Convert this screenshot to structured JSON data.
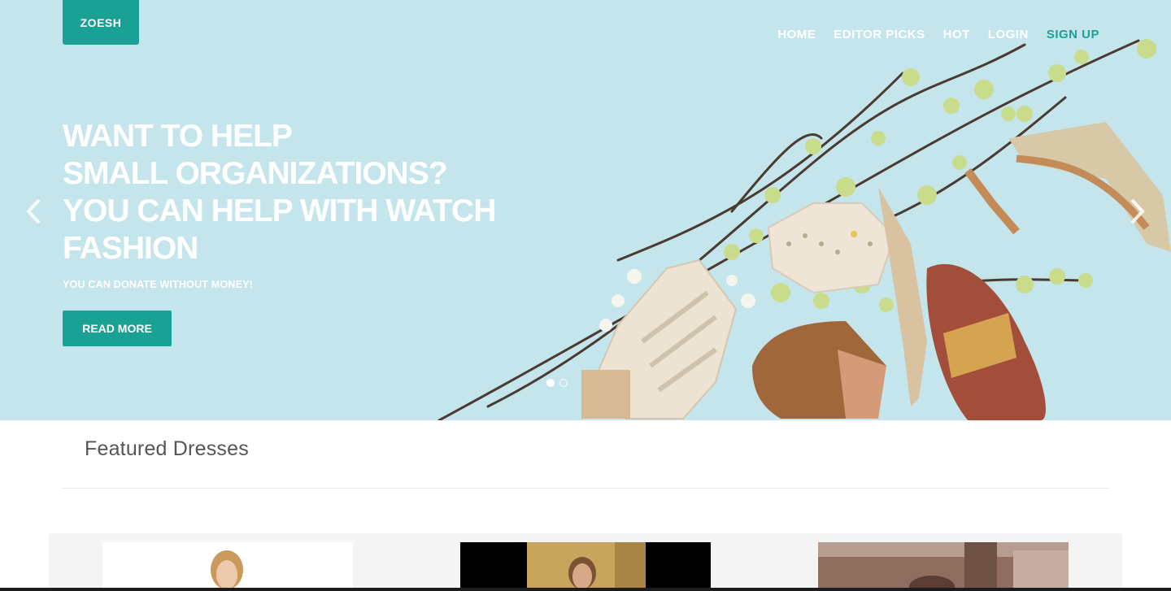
{
  "brand": {
    "logo": "ZOESH"
  },
  "nav": [
    {
      "label": "HOME",
      "active": false
    },
    {
      "label": "EDITOR PICKS",
      "active": false
    },
    {
      "label": "HOT",
      "active": false
    },
    {
      "label": "LOGIN",
      "active": false
    },
    {
      "label": "SIGN UP",
      "active": true
    }
  ],
  "hero": {
    "title_lines": [
      "WANT TO HELP",
      "SMALL ORGANIZATIONS?",
      "YOU CAN HELP WITH WATCH",
      "FASHION"
    ],
    "subtitle": "YOU CAN DONATE WITHOUT MONEY!",
    "button": "READ MORE",
    "slides_total": 2,
    "slide_active": 1
  },
  "featured": {
    "title": "Featured Dresses"
  },
  "colors": {
    "accent": "#1aa195",
    "hero_bg": "#c2e4eb"
  },
  "icons": {
    "prev": "chevron-left-icon",
    "next": "chevron-right-icon"
  }
}
